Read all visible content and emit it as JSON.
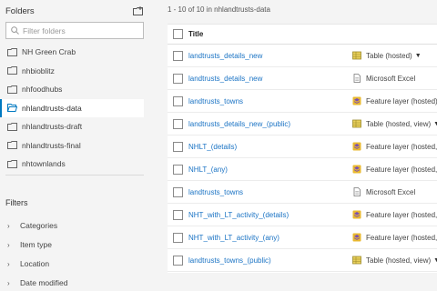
{
  "sidebar": {
    "folders_title": "Folders",
    "filter_placeholder": "Filter folders",
    "folders": [
      {
        "label": "NH Green Crab"
      },
      {
        "label": "nhbioblitz"
      },
      {
        "label": "nhfoodhubs"
      },
      {
        "label": "nhlandtrusts-data",
        "active": true
      },
      {
        "label": "nhlandtrusts-draft"
      },
      {
        "label": "nhlandtrusts-final"
      },
      {
        "label": "nhtownlands"
      }
    ],
    "filters_title": "Filters",
    "filter_categories": [
      {
        "label": "Categories"
      },
      {
        "label": "Item type"
      },
      {
        "label": "Location"
      },
      {
        "label": "Date modified"
      }
    ]
  },
  "main": {
    "count_text": "1 - 10 of 10 in nhlandtrusts-data",
    "header_title": "Title",
    "items": [
      {
        "title": "landtrusts_details_new",
        "type": "Table (hosted)",
        "icon": "table-icon",
        "dropdown": true
      },
      {
        "title": "landtrusts_details_new",
        "type": "Microsoft Excel",
        "icon": "document-icon",
        "dropdown": false
      },
      {
        "title": "landtrusts_towns",
        "type": "Feature layer (hosted)",
        "icon": "layer-icon",
        "dropdown": false
      },
      {
        "title": "landtrusts_details_new_(public)",
        "type": "Table (hosted, view)",
        "icon": "table-icon",
        "dropdown": true
      },
      {
        "title": "NHLT_(details)",
        "type": "Feature layer (hosted,",
        "icon": "layer-icon",
        "dropdown": false
      },
      {
        "title": "NHLT_(any)",
        "type": "Feature layer (hosted,",
        "icon": "layer-icon",
        "dropdown": false
      },
      {
        "title": "landtrusts_towns",
        "type": "Microsoft Excel",
        "icon": "document-icon",
        "dropdown": false
      },
      {
        "title": "NHT_with_LT_activity_(details)",
        "type": "Feature layer (hosted,",
        "icon": "layer-icon",
        "dropdown": false
      },
      {
        "title": "NHT_with_LT_activity_(any)",
        "type": "Feature layer (hosted,",
        "icon": "layer-icon",
        "dropdown": false
      },
      {
        "title": "landtrusts_towns_(public)",
        "type": "Table (hosted, view)",
        "icon": "table-icon",
        "dropdown": true
      }
    ]
  },
  "colors": {
    "accent": "#0079c1",
    "link": "#1a73c4",
    "background": "#f4f4f4"
  }
}
